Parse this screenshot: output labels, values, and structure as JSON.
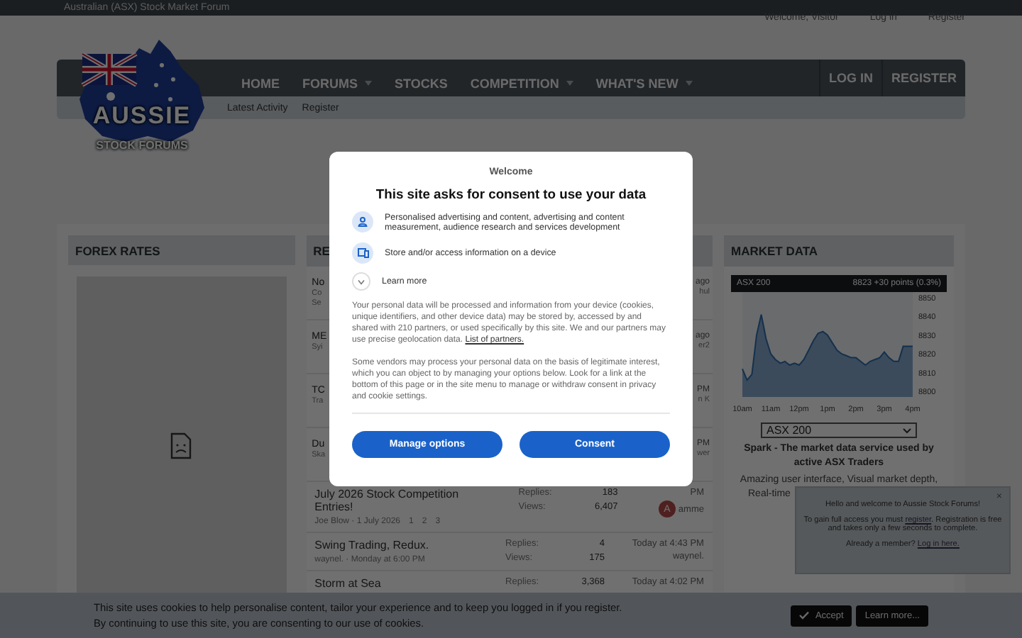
{
  "top_bar": {
    "site_name": "Australian (ASX) Stock Market Forum",
    "links": [
      "Welcome, Visitor",
      "Log in",
      "Register"
    ]
  },
  "logo": {
    "line1": "AUSSIE",
    "line2": "STOCK FORUMS"
  },
  "nav": {
    "items": [
      {
        "label": "HOME",
        "dropdown": false
      },
      {
        "label": "FORUMS",
        "dropdown": true
      },
      {
        "label": "STOCKS",
        "dropdown": false
      },
      {
        "label": "COMPETITION",
        "dropdown": true
      },
      {
        "label": "WHAT'S NEW",
        "dropdown": true
      }
    ],
    "right": [
      "LOG IN",
      "REGISTER"
    ],
    "sub_items": [
      "Latest Activity",
      "Register"
    ]
  },
  "forex": {
    "title": "FOREX RATES"
  },
  "threads": {
    "title": "RE",
    "rows": [
      {
        "kind": "partial",
        "left": [
          "No",
          "Co",
          "Se"
        ],
        "right": [
          "ago",
          "hul"
        ]
      },
      {
        "kind": "partial",
        "left": [
          "ME",
          "Syi"
        ],
        "right": [
          "ago",
          "er2"
        ]
      },
      {
        "kind": "partial",
        "left": [
          "TC",
          "Tra"
        ],
        "right": [
          "PM",
          "n K"
        ]
      },
      {
        "kind": "partial",
        "left": [
          "Du",
          "Ska"
        ],
        "right": [
          "PM",
          "wer"
        ]
      },
      {
        "kind": "full",
        "title": "July 2026 Stock Competition Entries!",
        "meta": "Joe Blow · 1 July 2026",
        "pages": [
          "1",
          "2",
          "3"
        ],
        "replies_label": "Replies:",
        "replies": "183",
        "views_label": "Views:",
        "views": "6,407",
        "time": "PM",
        "user": "amme",
        "avatar": "A"
      },
      {
        "kind": "full",
        "title": "Swing Trading, Redux.",
        "meta": "waynel. · Monday at 6:00 PM",
        "replies_label": "Replies:",
        "replies": "4",
        "views_label": "Views:",
        "views": "175",
        "time": "Today at 4:43 PM",
        "user": "waynel."
      },
      {
        "kind": "full",
        "title": "Storm at Sea",
        "replies_label": "Replies:",
        "replies": "3,368",
        "time": "Today at 4:02 PM"
      }
    ]
  },
  "market": {
    "title": "MARKET DATA",
    "quote": "8823  +30 points  (0.3%)",
    "chart_data": {
      "type": "area",
      "categories": [
        "10am",
        null,
        null,
        null,
        null,
        null,
        "11am",
        null,
        null,
        null,
        null,
        null,
        "12pm",
        null,
        null,
        null,
        null,
        null,
        "1pm",
        null,
        null,
        null,
        null,
        null,
        "2pm",
        null,
        null,
        null,
        null,
        null,
        "3pm",
        null,
        null,
        null,
        null,
        null,
        "4pm"
      ],
      "series": [
        {
          "name": "ASX 200",
          "color": "#2f6db0",
          "values": [
            8812,
            8806,
            8809,
            8830,
            8841,
            8828,
            8820,
            8817,
            8815,
            8816,
            8814,
            8815,
            8814,
            8817,
            8822,
            8827,
            8831,
            8832,
            8830,
            8826,
            8822,
            8820,
            8819,
            8818,
            8818,
            8816,
            8814,
            8816,
            8817,
            8818,
            8821,
            8818,
            8816,
            8816,
            8824,
            8824,
            8824
          ]
        }
      ],
      "ylim": [
        8797,
        8853
      ],
      "yticks": [
        8800,
        8810,
        8820,
        8830,
        8840,
        8850
      ]
    },
    "select_value": "ASX 200",
    "promo_title": "Spark - The market data service used by active ASX Traders",
    "promo_lines": [
      "Amazing user interface, Visual market depth,",
      "Real-time"
    ]
  },
  "welcome_popup": {
    "greeting": "Hello and welcome to Aussie Stock Forums!",
    "text": "To gain full access you must ",
    "register_link": "register",
    "text_after": ". Registration is free and takes only a few seconds to complete.",
    "member_text": "Already a member? ",
    "login_link": "Log in here.",
    "close": "×"
  },
  "cookie_bar": {
    "lines": [
      "This site uses cookies to help personalise content, tailor your experience and to keep you logged in if you register.",
      "By continuing to use this site, you are consenting to our use of cookies."
    ],
    "accept": "Accept",
    "learn_more": "Learn more..."
  },
  "consent_modal": {
    "welcome": "Welcome",
    "title": "This site asks for consent to use your data",
    "purposes": [
      {
        "kind": "person",
        "text": "Personalised advertising and content, advertising and content measurement, audience research and services development"
      },
      {
        "kind": "device",
        "text": "Store and/or access information on a device"
      }
    ],
    "learn_more": {
      "label": "Learn more",
      "expanded": false
    },
    "paragraph1": "Your personal data will be processed and information from your device (cookies, unique identifiers, and other device data) may be stored by, accessed by and shared with 210 partners, or used specifically by this site. We and our partners may use precise geolocation data. ",
    "partners_link": "List of partners.",
    "paragraph2": "Some vendors may process your personal data on the basis of legitimate interest, which you can object to by managing your options below. Look for a link at the bottom of this page or in the site menu to manage or withdraw consent in privacy and cookie settings.",
    "buttons": [
      "Manage options",
      "Consent"
    ]
  }
}
